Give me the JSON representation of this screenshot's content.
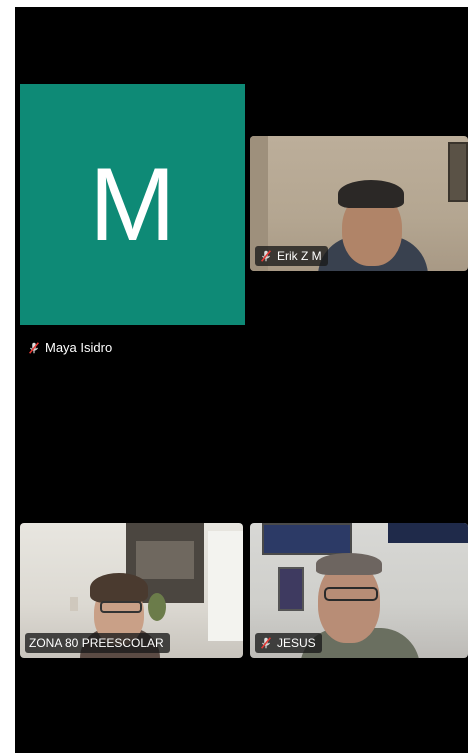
{
  "avatar_tile": {
    "letter": "M",
    "name": "Maya Isidro",
    "color": "#0e8a76"
  },
  "video_tiles": [
    {
      "name": "Erik Z M",
      "muted": true
    },
    {
      "name": "ZONA 80 PREESCOLAR",
      "muted": false
    },
    {
      "name": "JESUS",
      "muted": true
    }
  ],
  "colors": {
    "background": "#000000",
    "label_bg": "#191919"
  },
  "icons": {
    "mute": "mic-muted-icon"
  }
}
